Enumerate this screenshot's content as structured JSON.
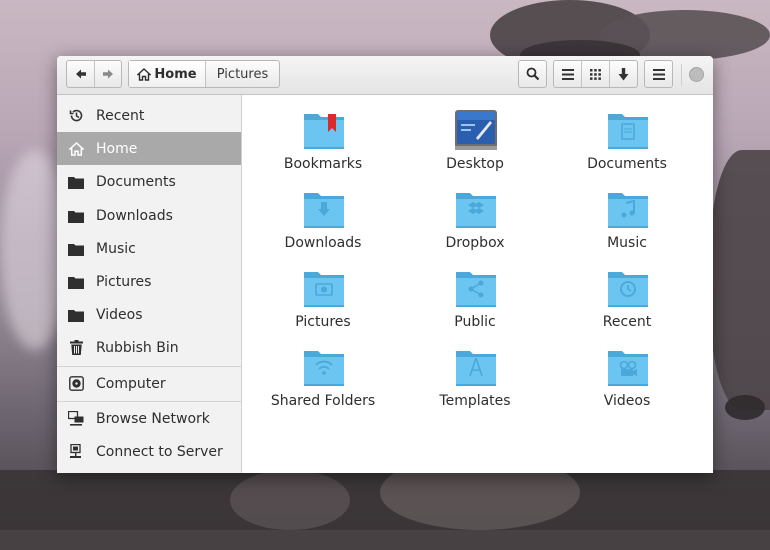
{
  "window": {
    "path": {
      "home_label": "Home",
      "pictures_label": "Pictures"
    }
  },
  "sidebar": {
    "items": [
      {
        "label": "Recent",
        "icon": "clock-icon"
      },
      {
        "label": "Home",
        "icon": "home-icon",
        "active": true
      },
      {
        "label": "Documents",
        "icon": "folder-icon"
      },
      {
        "label": "Downloads",
        "icon": "folder-icon"
      },
      {
        "label": "Music",
        "icon": "folder-icon"
      },
      {
        "label": "Pictures",
        "icon": "folder-icon"
      },
      {
        "label": "Videos",
        "icon": "folder-icon"
      },
      {
        "label": "Rubbish Bin",
        "icon": "trash-icon"
      },
      {
        "label": "Computer",
        "icon": "drive-icon"
      },
      {
        "label": "Browse Network",
        "icon": "network-icon"
      },
      {
        "label": "Connect to Server",
        "icon": "server-icon"
      }
    ]
  },
  "files": [
    {
      "label": "Bookmarks",
      "icon": "bookmarks-folder-icon"
    },
    {
      "label": "Desktop",
      "icon": "desktop-folder-icon"
    },
    {
      "label": "Documents",
      "icon": "documents-folder-icon"
    },
    {
      "label": "Downloads",
      "icon": "downloads-folder-icon"
    },
    {
      "label": "Dropbox",
      "icon": "dropbox-folder-icon"
    },
    {
      "label": "Music",
      "icon": "music-folder-icon"
    },
    {
      "label": "Pictures",
      "icon": "pictures-folder-icon"
    },
    {
      "label": "Public",
      "icon": "public-folder-icon"
    },
    {
      "label": "Recent",
      "icon": "recent-folder-icon"
    },
    {
      "label": "Shared Folders",
      "icon": "shared-folder-icon"
    },
    {
      "label": "Templates",
      "icon": "templates-folder-icon"
    },
    {
      "label": "Videos",
      "icon": "videos-folder-icon"
    }
  ],
  "colors": {
    "folder": "#6cc4f0",
    "folder_dark": "#4aa8db",
    "accent_red": "#d92b2b",
    "sidebar_active": "#a9a9a9"
  }
}
